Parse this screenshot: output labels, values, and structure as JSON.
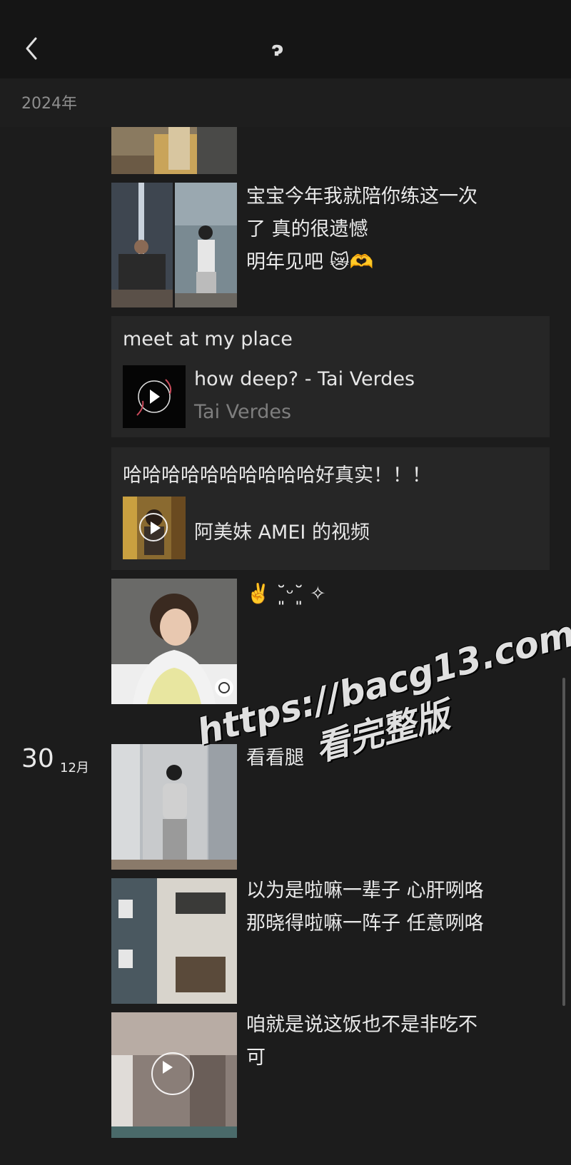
{
  "header": {
    "title": "ɂ",
    "year_label": "2024年"
  },
  "posts": [
    {
      "caption": "宝宝今年我就陪你练这一次\n了 真的很遗憾\n明年见吧 😿🫶"
    },
    {
      "card_title": "meet at my place",
      "song_title": "how deep? - Tai Verdes",
      "song_artist": "Tai Verdes"
    },
    {
      "card_title": "哈哈哈哈哈哈哈哈哈哈好真实！！！",
      "video_label": "阿美妹 AMEI 的视频"
    },
    {
      "caption": "✌️ ˘͈ᵕ˘͈ ✧"
    }
  ],
  "date_group": {
    "day": "30",
    "month": "12月"
  },
  "posts_dec30": [
    {
      "caption": "看看腿"
    },
    {
      "caption": "以为是啦嘛一辈子 心肝咧咯\n那晓得啦嘛一阵子 任意咧咯"
    },
    {
      "caption": "咱就是说这饭也不是非吃不\n可"
    }
  ],
  "watermark": {
    "line1": "https://bacg13.com",
    "line2": "看完整版"
  }
}
